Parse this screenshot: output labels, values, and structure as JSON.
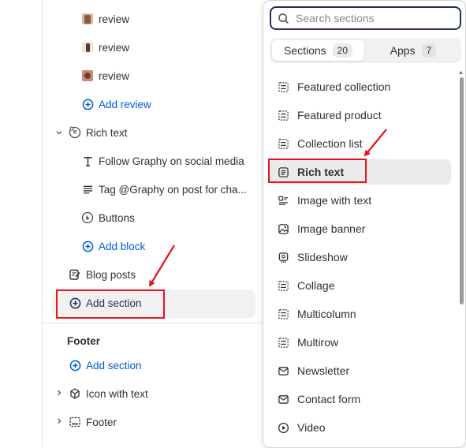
{
  "left": {
    "reviews": [
      {
        "label": "review",
        "thumb_color": "#b07a5a"
      },
      {
        "label": "review",
        "thumb_color": "#6b4a3a"
      },
      {
        "label": "review",
        "thumb_color": "#a0584a"
      }
    ],
    "add_review": "Add review",
    "rich_text_group": "Rich text",
    "rich_text_blocks": [
      {
        "label": "Follow Graphy on social media",
        "icon": "text-heading-icon"
      },
      {
        "label": "Tag @Graphy on post for cha...",
        "icon": "paragraph-icon"
      },
      {
        "label": "Buttons",
        "icon": "button-icon"
      }
    ],
    "add_block": "Add block",
    "blog_posts": "Blog posts",
    "add_section": "Add section",
    "footer_heading": "Footer",
    "footer_add_section": "Add section",
    "footer_items": [
      {
        "label": "Icon with text",
        "icon": "icon-with-text-icon"
      },
      {
        "label": "Footer",
        "icon": "footer-icon"
      }
    ]
  },
  "dropdown": {
    "search_placeholder": "Search sections",
    "tabs": [
      {
        "label": "Sections",
        "count": "20"
      },
      {
        "label": "Apps",
        "count": "7"
      }
    ],
    "sections": [
      {
        "label": "Featured collection",
        "icon": "layout-icon"
      },
      {
        "label": "Featured product",
        "icon": "layout-icon"
      },
      {
        "label": "Collection list",
        "icon": "layout-icon"
      },
      {
        "label": "Rich text",
        "icon": "text-block-icon"
      },
      {
        "label": "Image with text",
        "icon": "image-with-text-icon"
      },
      {
        "label": "Image banner",
        "icon": "image-icon"
      },
      {
        "label": "Slideshow",
        "icon": "slideshow-icon"
      },
      {
        "label": "Collage",
        "icon": "layout-icon"
      },
      {
        "label": "Multicolumn",
        "icon": "layout-icon"
      },
      {
        "label": "Multirow",
        "icon": "layout-icon"
      },
      {
        "label": "Newsletter",
        "icon": "mail-icon"
      },
      {
        "label": "Contact form",
        "icon": "mail-icon"
      },
      {
        "label": "Video",
        "icon": "play-icon"
      }
    ]
  },
  "colors": {
    "accent": "#005bd3",
    "annotation_red": "#e8121b",
    "selected_bg": "#ebebeb"
  }
}
